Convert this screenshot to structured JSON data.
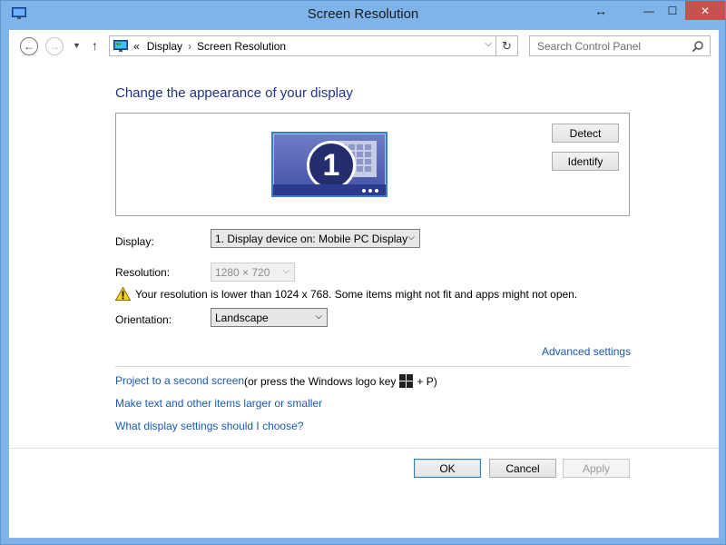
{
  "window": {
    "title": "Screen Resolution",
    "controls": {
      "move": "↔",
      "minimize": "—",
      "maximize": "☐",
      "close": "✕"
    }
  },
  "addressbar": {
    "crumb_prefix": "«",
    "breadcrumb": [
      "Display",
      "Screen Resolution"
    ],
    "separator": "›",
    "search_placeholder": "Search Control Panel"
  },
  "main": {
    "heading": "Change the appearance of your display",
    "monitor_number": "1",
    "detect_label": "Detect",
    "identify_label": "Identify",
    "display_label": "Display:",
    "display_value": "1. Display device on: Mobile PC Display",
    "resolution_label": "Resolution:",
    "resolution_value": "1280 × 720",
    "warning_text": "Your resolution is lower than 1024 x 768. Some items might not fit and apps might not open.",
    "orientation_label": "Orientation:",
    "orientation_value": "Landscape",
    "advanced_link": "Advanced settings",
    "project_link": "Project to a second screen",
    "project_suffix_before": "(or press the Windows logo key",
    "project_suffix_after": "+ P)",
    "text_size_link": "Make text and other items larger or smaller",
    "choose_link": "What display settings should I choose?"
  },
  "footer": {
    "ok_label": "OK",
    "cancel_label": "Cancel",
    "apply_label": "Apply"
  },
  "colors": {
    "frame": "#7eb4ea",
    "close": "#c75050",
    "heading": "#1e3287",
    "link": "#1a5ab6"
  }
}
